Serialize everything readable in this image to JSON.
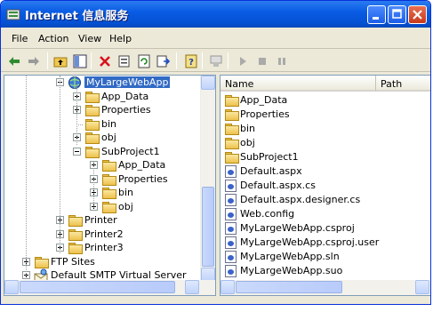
{
  "window": {
    "title": "Internet 信息服务"
  },
  "menu": [
    "File",
    "Action",
    "View",
    "Help"
  ],
  "toolbar": [
    "back-arrow-icon",
    "forward-arrow-icon",
    "up-folder-icon",
    "show-hide-tree-icon",
    "delete-icon",
    "properties-icon",
    "refresh-icon",
    "export-list-icon",
    "help-icon",
    "computer-icon",
    "start-icon",
    "stop-icon",
    "pause-icon"
  ],
  "tree": [
    {
      "label": "MyLargeWebApp",
      "icon": "globe",
      "selected": true,
      "expander": "minus",
      "level": 2
    },
    {
      "label": "App_Data",
      "icon": "folder",
      "expander": "plus",
      "level": 3
    },
    {
      "label": "Properties",
      "icon": "folder",
      "expander": "plus",
      "level": 3
    },
    {
      "label": "bin",
      "icon": "folder",
      "expander": "",
      "level": 3
    },
    {
      "label": "obj",
      "icon": "folder",
      "expander": "plus",
      "level": 3
    },
    {
      "label": "SubProject1",
      "icon": "folder",
      "expander": "minus",
      "level": 3
    },
    {
      "label": "App_Data",
      "icon": "folder",
      "expander": "plus",
      "level": 4
    },
    {
      "label": "Properties",
      "icon": "folder",
      "expander": "plus",
      "level": 4
    },
    {
      "label": "bin",
      "icon": "folder",
      "expander": "plus",
      "level": 4
    },
    {
      "label": "obj",
      "icon": "folder",
      "expander": "plus",
      "level": 4
    },
    {
      "label": "Printer",
      "icon": "folder",
      "expander": "plus",
      "level": 2
    },
    {
      "label": "Printer2",
      "icon": "folder",
      "expander": "plus",
      "level": 2
    },
    {
      "label": "Printer3",
      "icon": "folder",
      "expander": "plus",
      "level": 2
    },
    {
      "label": "FTP Sites",
      "icon": "folder",
      "expander": "plus",
      "level": 1
    },
    {
      "label": "Default SMTP Virtual Server",
      "icon": "smtp",
      "expander": "plus",
      "level": 1
    }
  ],
  "list": {
    "columns": [
      "Name",
      "Path"
    ],
    "items": [
      {
        "name": "App_Data",
        "icon": "folder"
      },
      {
        "name": "Properties",
        "icon": "folder"
      },
      {
        "name": "bin",
        "icon": "folder"
      },
      {
        "name": "obj",
        "icon": "folder"
      },
      {
        "name": "SubProject1",
        "icon": "folder"
      },
      {
        "name": "Default.aspx",
        "icon": "file"
      },
      {
        "name": "Default.aspx.cs",
        "icon": "file"
      },
      {
        "name": "Default.aspx.designer.cs",
        "icon": "file"
      },
      {
        "name": "Web.config",
        "icon": "file"
      },
      {
        "name": "MyLargeWebApp.csproj",
        "icon": "file"
      },
      {
        "name": "MyLargeWebApp.csproj.user",
        "icon": "file"
      },
      {
        "name": "MyLargeWebApp.sln",
        "icon": "file"
      },
      {
        "name": "MyLargeWebApp.suo",
        "icon": "file"
      }
    ]
  }
}
